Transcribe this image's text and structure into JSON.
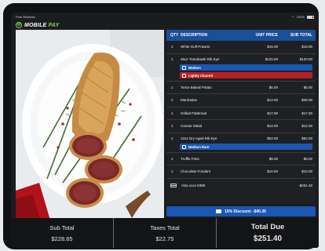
{
  "status": {
    "left": "Free Wireless",
    "right": "100%"
  },
  "brand": {
    "name_a": "MOBILE ",
    "name_b": "PAY",
    "mark": "M"
  },
  "table_headers": {
    "qty": "QTY",
    "description": "DESCRIPTION",
    "unit_price": "UNIT PRICE",
    "sub_total": "SUB TOTAL"
  },
  "items": [
    {
      "qty": "1",
      "description": "White Gulf Prawns",
      "unit": "$16.00",
      "sub": "$16.00"
    },
    {
      "qty": "1",
      "description": "46oz Tomahawk Rib Eye",
      "unit": "$120.00",
      "sub": "$120.00",
      "mods": [
        "Medium",
        "Lightly Charred"
      ]
    },
    {
      "qty": "1",
      "description": "Twice Baked Potato",
      "unit": "$6.00",
      "sub": "$6.00"
    },
    {
      "qty": "2",
      "description": "Manhattan",
      "unit": "$14.00",
      "sub": "$28.00"
    },
    {
      "qty": "1",
      "description": "Grilled Flatbread",
      "unit": "$17.00",
      "sub": "$17.00"
    },
    {
      "qty": "1",
      "description": "Caesar Salad",
      "unit": "$12.00",
      "sub": "$12.00"
    },
    {
      "qty": "1",
      "description": "12oz Dry Aged Rib Eye",
      "unit": "$52.00",
      "sub": "$52.00",
      "mods": [
        "Medium Rare"
      ]
    },
    {
      "qty": "1",
      "description": "Truffle Fries",
      "unit": "$8.00",
      "sub": "$8.00"
    },
    {
      "qty": "1",
      "description": "Chocolate Fondant",
      "unit": "$10.00",
      "sub": "$10.00"
    }
  ],
  "payment": {
    "label": "Visa xxxx 6389",
    "amount": "-$251.40"
  },
  "discount": {
    "label": "15% Discount: -$40.35"
  },
  "totals": {
    "subtotal_label": "Sub Total",
    "subtotal_value": "$228.65",
    "taxes_label": "Taxes Total",
    "taxes_value": "$22.75",
    "due_label": "Total Due",
    "due_value": "$251.40"
  },
  "colors": {
    "header_blue": "#1a4f9a",
    "modifier_blue": "#1b57b3",
    "modifier_red": "#b72025",
    "brand_green": "#8cd04e"
  }
}
